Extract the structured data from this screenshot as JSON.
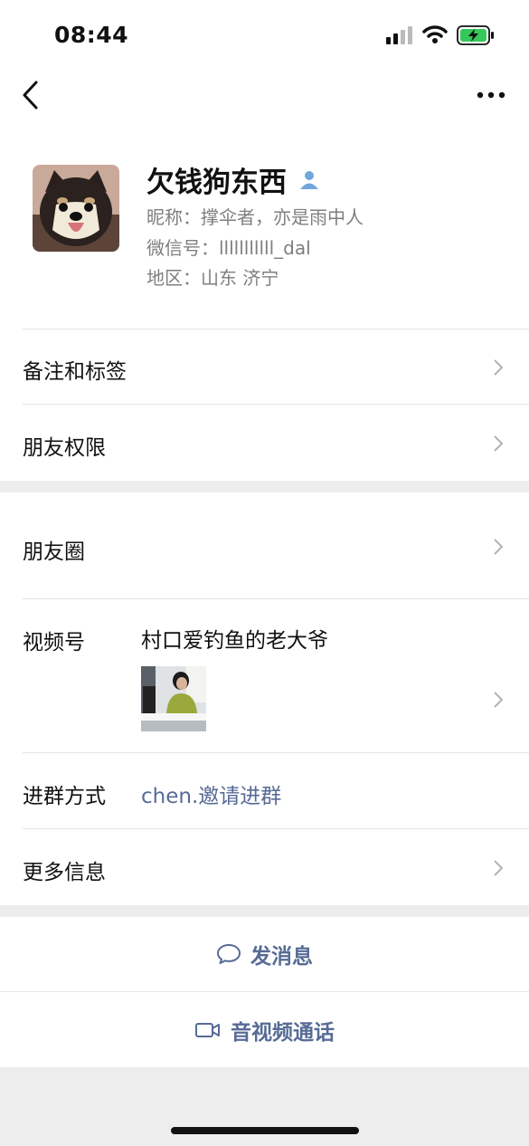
{
  "status_bar": {
    "time": "08:44"
  },
  "profile": {
    "display_name": "欠钱狗东西",
    "nickname": "昵称：撑伞者，亦是雨中人",
    "wechat_id": "微信号：lllllllllll_dal",
    "region": "地区：山东 济宁"
  },
  "menu": {
    "remark_tags": "备注和标签",
    "friend_permissions": "朋友权限",
    "moments": "朋友圈",
    "channels_label": "视频号",
    "channels_name": "村口爱钓鱼的老大爷",
    "join_group_label": "进群方式",
    "join_group_value": "chen.邀请进群",
    "more_info": "更多信息"
  },
  "actions": {
    "send_message": "发消息",
    "video_call": "音视频通话"
  },
  "colors": {
    "link": "#576b95",
    "battery": "#34c759",
    "background": "#ededed"
  }
}
